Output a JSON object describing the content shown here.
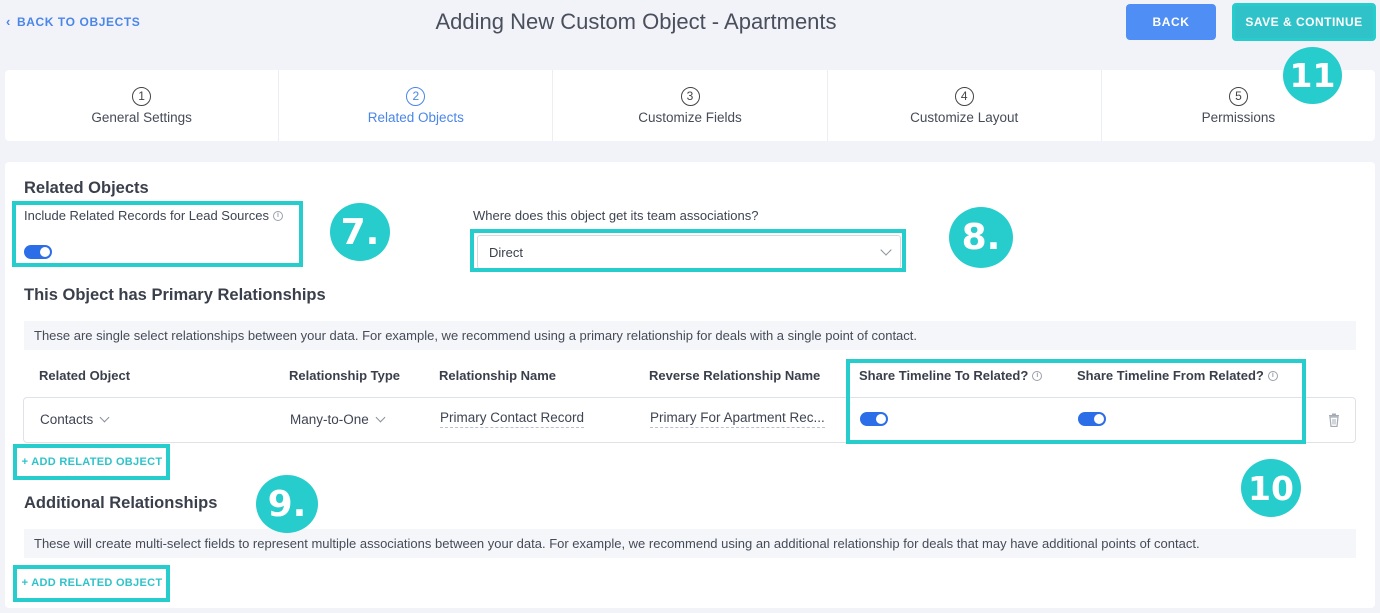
{
  "header": {
    "back_link": "BACK TO OBJECTS",
    "title": "Adding New Custom Object - Apartments",
    "back_button": "BACK",
    "save_button": "SAVE & CONTINUE"
  },
  "steps": [
    {
      "num": "1",
      "label": "General Settings"
    },
    {
      "num": "2",
      "label": "Related Objects"
    },
    {
      "num": "3",
      "label": "Customize Fields"
    },
    {
      "num": "4",
      "label": "Customize Layout"
    },
    {
      "num": "5",
      "label": "Permissions"
    }
  ],
  "related": {
    "heading": "Related Objects",
    "include_label": "Include Related Records for Lead Sources",
    "team_question": "Where does this object get its team associations?",
    "team_value": "Direct"
  },
  "primary": {
    "heading": "This Object has Primary Relationships",
    "note": "These are single select relationships between your data. For example, we recommend using a primary relationship for deals with a single point of contact.",
    "columns": [
      "Related Object",
      "Relationship Type",
      "Relationship Name",
      "Reverse Relationship Name",
      "Share Timeline To Related?",
      "Share Timeline From Related?"
    ],
    "row": {
      "related_object": "Contacts",
      "relationship_type": "Many-to-One",
      "relationship_name": "Primary Contact Record",
      "reverse_name": "Primary For Apartment Rec..."
    },
    "add_button": "+ ADD RELATED OBJECT"
  },
  "additional": {
    "heading": "Additional Relationships",
    "note": "These will create multi-select fields to represent multiple associations between your data. For example, we recommend using an additional relationship for deals that may have additional points of contact.",
    "add_button": "+ ADD RELATED OBJECT"
  },
  "callouts": {
    "c7": "7.",
    "c8": "8.",
    "c9": "9.",
    "c10": "10",
    "c11": "11"
  },
  "colors": {
    "accent": "#4a86e8",
    "teal": "#27cccc",
    "toggle": "#2b6ee8"
  }
}
